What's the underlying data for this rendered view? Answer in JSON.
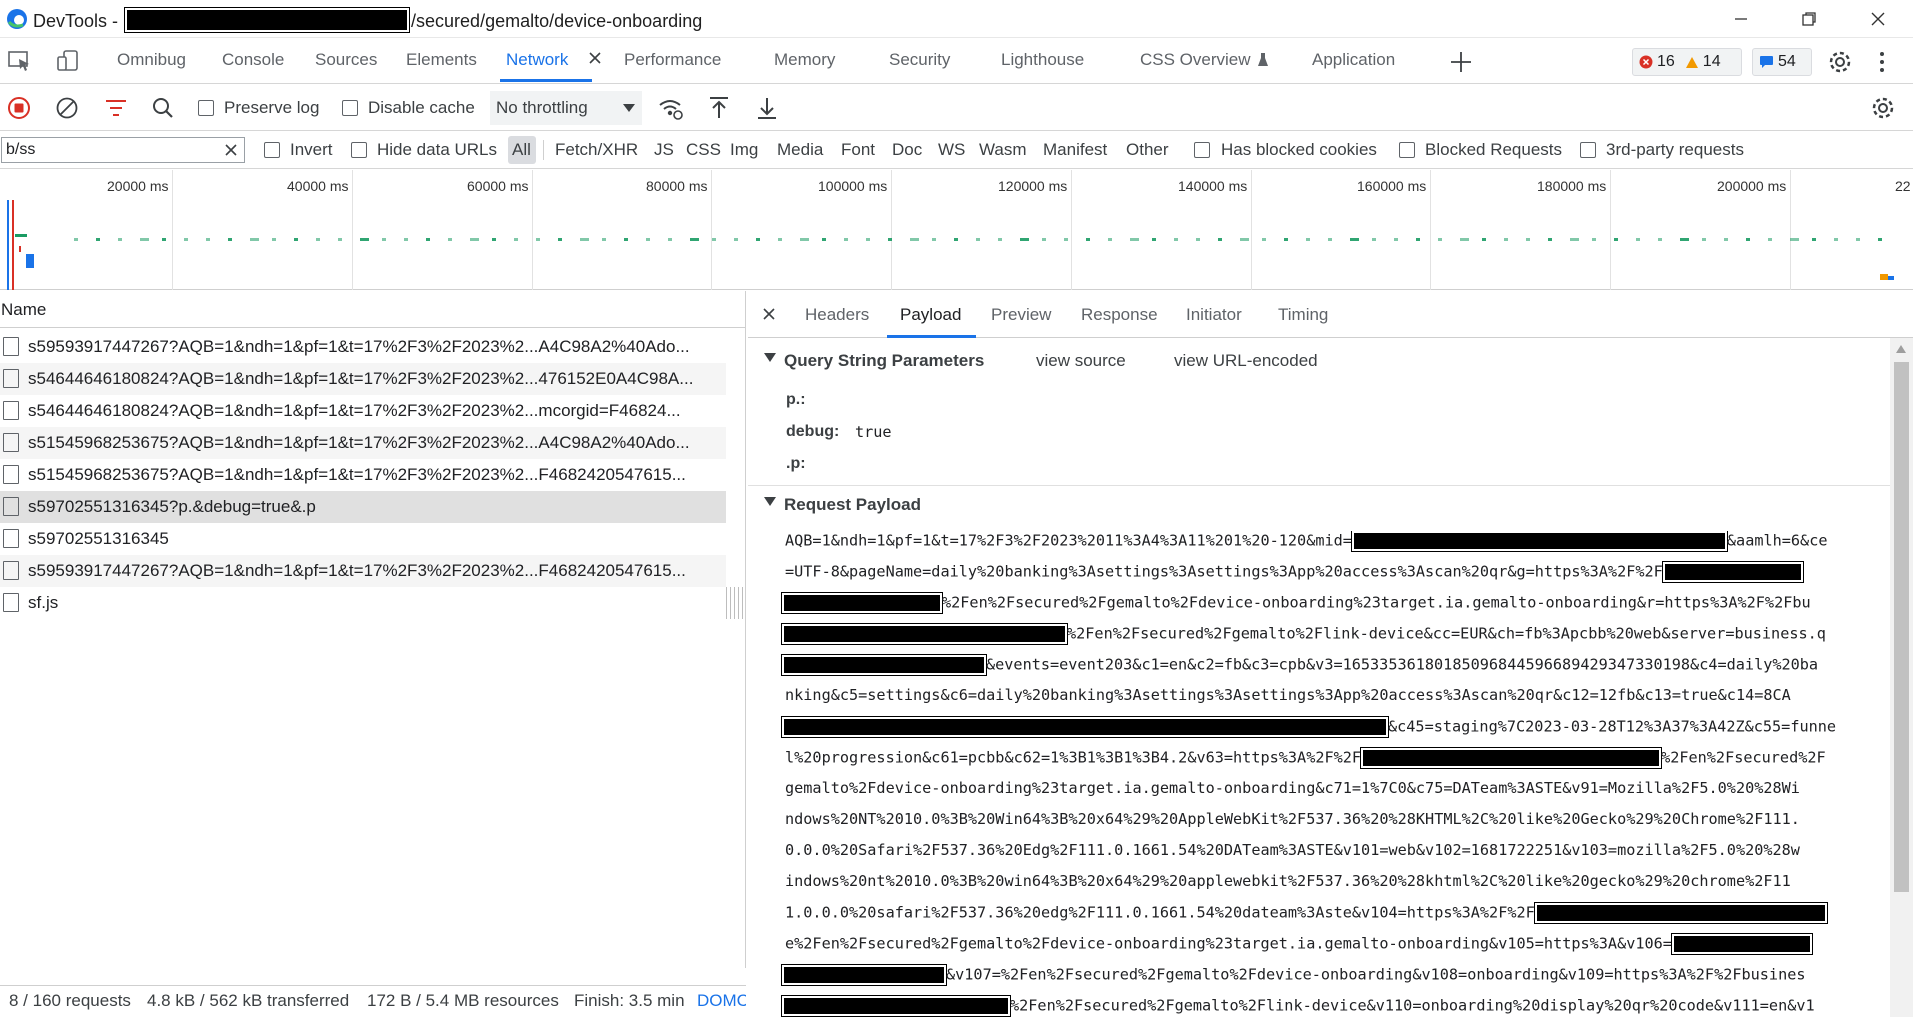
{
  "window": {
    "title_prefix": "DevTools - ",
    "title_suffix": "/secured/gemalto/device-onboarding"
  },
  "tabs": [
    {
      "label": "Omnibug"
    },
    {
      "label": "Console"
    },
    {
      "label": "Sources"
    },
    {
      "label": "Elements"
    },
    {
      "label": "Network"
    },
    {
      "label": "Performance"
    },
    {
      "label": "Memory"
    },
    {
      "label": "Security"
    },
    {
      "label": "Lighthouse"
    },
    {
      "label": "CSS Overview"
    },
    {
      "label": "Application"
    }
  ],
  "issues": {
    "errors": "16",
    "warnings": "14",
    "messages": "54"
  },
  "toolbar": {
    "preserve_log": "Preserve log",
    "disable_cache": "Disable cache",
    "throttling": "No throttling"
  },
  "filter": {
    "value": "b/ss",
    "invert": "Invert",
    "hide_data_urls": "Hide data URLs",
    "types": [
      "All",
      "Fetch/XHR",
      "JS",
      "CSS",
      "Img",
      "Media",
      "Font",
      "Doc",
      "WS",
      "Wasm",
      "Manifest",
      "Other"
    ],
    "has_blocked_cookies": "Has blocked cookies",
    "blocked_requests": "Blocked Requests",
    "third_party": "3rd-party requests"
  },
  "overview": {
    "ticks": [
      "20000 ms",
      "40000 ms",
      "60000 ms",
      "80000 ms",
      "100000 ms",
      "120000 ms",
      "140000 ms",
      "160000 ms",
      "180000 ms",
      "200000 ms",
      "22"
    ]
  },
  "requests": {
    "header": "Name",
    "rows": [
      "s59593917447267?AQB=1&ndh=1&pf=1&t=17%2F3%2F2023%2...A4C98A2%40Ado...",
      "s54644646180824?AQB=1&ndh=1&pf=1&t=17%2F3%2F2023%2...476152E0A4C98A...",
      "s54644646180824?AQB=1&ndh=1&pf=1&t=17%2F3%2F2023%2...mcorgid=F46824...",
      "s51545968253675?AQB=1&ndh=1&pf=1&t=17%2F3%2F2023%2...A4C98A2%40Ado...",
      "s51545968253675?AQB=1&ndh=1&pf=1&t=17%2F3%2F2023%2...F4682420547615...",
      "s59702551316345?p.&debug=true&.p",
      "s59702551316345",
      "s59593917447267?AQB=1&ndh=1&pf=1&t=17%2F3%2F2023%2...F4682420547615...",
      "sf.js"
    ]
  },
  "status": {
    "requests": "8 / 160 requests",
    "transferred": "4.8 kB / 562 kB transferred",
    "resources": "172 B / 5.4 MB resources",
    "finish": "Finish: 3.5 min",
    "domc": "DOMC"
  },
  "details": {
    "tabs": [
      "Headers",
      "Payload",
      "Preview",
      "Response",
      "Initiator",
      "Timing"
    ],
    "query_section": "Query String Parameters",
    "view_source": "view source",
    "view_url_encoded": "view URL-encoded",
    "params": [
      {
        "key": "p.:",
        "value": ""
      },
      {
        "key": "debug:",
        "value": "true"
      },
      {
        "key": ".p:",
        "value": ""
      }
    ],
    "payload_section": "Request Payload",
    "payload_lines": [
      {
        "a": "AQB=1&ndh=1&pf=1&t=17%2F3%2F2023%2011%3A4%3A11%201%20-120&mid=",
        "b": "&aamlh=6&ce"
      },
      {
        "a": "=UTF-8&pageName=daily%20banking%3Asettings%3Asettings%3App%20access%3Ascan%20qr&g=https%3A%2F%2F",
        "b": ""
      },
      {
        "a": "",
        "b": "%2Fen%2Fsecured%2Fgemalto%2Fdevice-onboarding%23target.ia.gemalto-onboarding&r=https%3A%2F%2Fbu"
      },
      {
        "a": "",
        "b": "%2Fen%2Fsecured%2Fgemalto%2Flink-device&cc=EUR&ch=fb%3Apcbb%20web&server=business.q"
      },
      {
        "a": "",
        "b": "&events=event203&c1=en&c2=fb&c3=cpb&v3=16533536180185096844596689429347330198&c4=daily%20ba"
      },
      {
        "a": "nking&c5=settings&c6=daily%20banking%3Asettings%3Asettings%3App%20access%3Ascan%20qr&c12=12fb&c13=true&c14=8CA",
        "b": ""
      },
      {
        "a": "",
        "b": "&c45=staging%7C2023-03-28T12%3A37%3A42Z&c55=funne"
      },
      {
        "a": "l%20progression&c61=pcbb&c62=1%3B1%3B1%3B4.2&v63=https%3A%2F%2F",
        "b": "%2Fen%2Fsecured%2F"
      },
      {
        "a": "gemalto%2Fdevice-onboarding%23target.ia.gemalto-onboarding&c71=1%7C0&c75=DATeam%3ASTE&v91=Mozilla%2F5.0%20%28Wi",
        "b": ""
      },
      {
        "a": "ndows%20NT%2010.0%3B%20Win64%3B%20x64%29%20AppleWebKit%2F537.36%20%28KHTML%2C%20like%20Gecko%29%20Chrome%2F111.",
        "b": ""
      },
      {
        "a": "0.0.0%20Safari%2F537.36%20Edg%2F111.0.1661.54%20DATeam%3ASTE&v101=web&v102=1681722251&v103=mozilla%2F5.0%20%28w",
        "b": ""
      },
      {
        "a": "indows%20nt%2010.0%3B%20win64%3B%20x64%29%20applewebkit%2F537.36%20%28khtml%2C%20like%20gecko%29%20chrome%2F11",
        "b": ""
      },
      {
        "a": "1.0.0.0%20safari%2F537.36%20edg%2F111.0.1661.54%20dateam%3Aste&v104=https%3A%2F%2F",
        "b": ""
      },
      {
        "a": "e%2Fen%2Fsecured%2Fgemalto%2Fdevice-onboarding%23target.ia.gemalto-onboarding&v105=https%3A&v106=",
        "b": ""
      },
      {
        "a": "",
        "b": "&v107=%2Fen%2Fsecured%2Fgemalto%2Fdevice-onboarding&v108=onboarding&v109=https%3A%2F%2Fbusines"
      },
      {
        "a": "",
        "b": "%2Fen%2Fsecured%2Fgemalto%2Flink-device&v110=onboarding%20display%20qr%20code&v111=en&v1"
      }
    ]
  },
  "colors": {
    "accent": "#1a73e8",
    "record": "#d93025",
    "waterfall": "#1a9b63",
    "selected_row": "#e0e0e0"
  }
}
